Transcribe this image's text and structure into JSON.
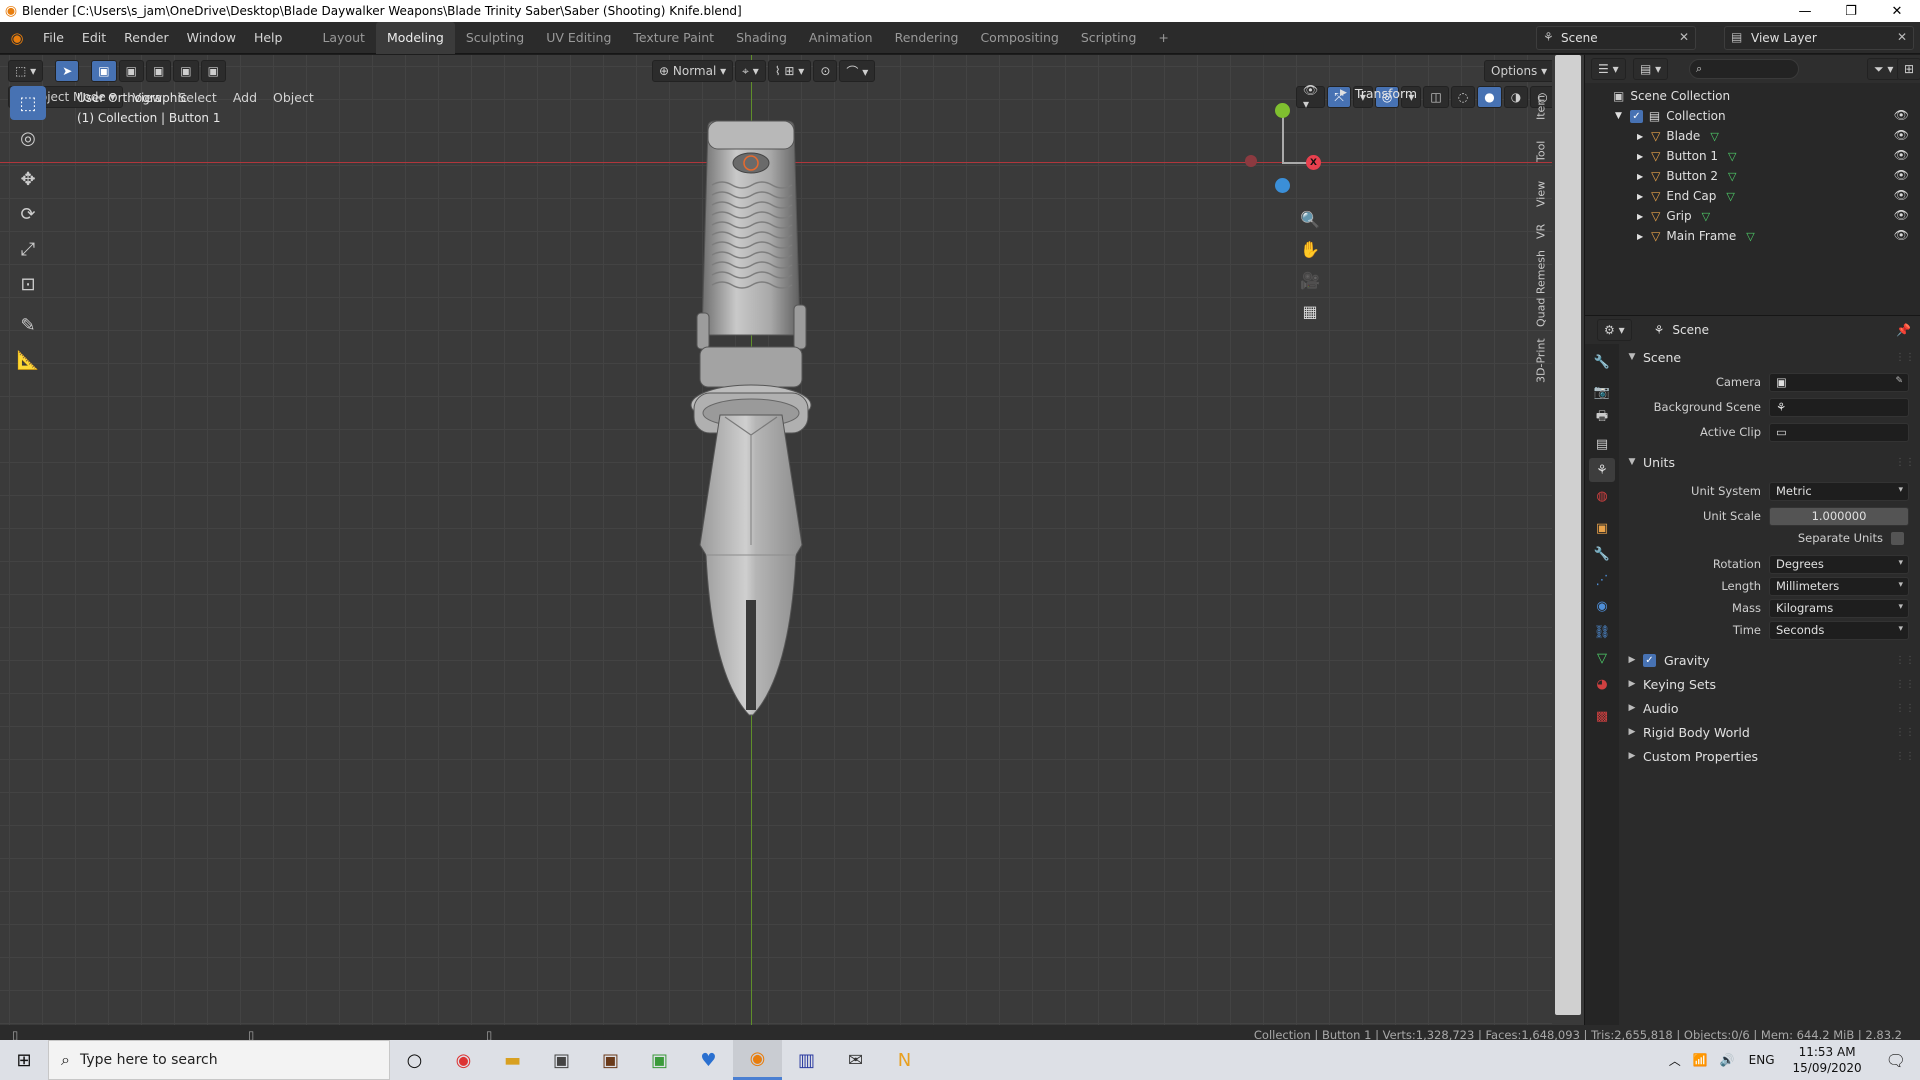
{
  "window": {
    "title": "Blender [C:\\Users\\s_jam\\OneDrive\\Desktop\\Blade Daywalker Weapons\\Blade Trinity Saber\\Saber (Shooting) Knife.blend]",
    "minimize": "—",
    "maximize": "❐",
    "close": "✕"
  },
  "menus": [
    "File",
    "Edit",
    "Render",
    "Window",
    "Help"
  ],
  "workspaces": [
    "Layout",
    "Modeling",
    "Sculpting",
    "UV Editing",
    "Texture Paint",
    "Shading",
    "Animation",
    "Rendering",
    "Compositing",
    "Scripting",
    "+"
  ],
  "active_workspace": "Modeling",
  "scene_field": "Scene",
  "view_layer_field": "View Layer",
  "viewport": {
    "mode": "Object Mode",
    "menus": [
      "View",
      "Select",
      "Add",
      "Object"
    ],
    "orientation": "Normal",
    "options": "Options",
    "view_name": "User Orthographic",
    "context": "(1) Collection | Button 1",
    "transform_panel": "Transform",
    "side_tabs": [
      "Item",
      "Tool",
      "View",
      "VR",
      "Quad Remesh",
      "3D-Print"
    ],
    "gizmo": {
      "x": "X",
      "y": "Y",
      "z": "Z"
    }
  },
  "outliner": {
    "root": "Scene Collection",
    "collection": "Collection",
    "objects": [
      "Blade",
      "Button 1",
      "Button 2",
      "End Cap",
      "Grip",
      "Main Frame"
    ]
  },
  "properties": {
    "header": "Scene",
    "scene_section": "Scene",
    "camera_label": "Camera",
    "background_scene_label": "Background Scene",
    "active_clip_label": "Active Clip",
    "units_section": "Units",
    "unit_system_label": "Unit System",
    "unit_system": "Metric",
    "unit_scale_label": "Unit Scale",
    "unit_scale": "1.000000",
    "separate_units_label": "Separate Units",
    "rotation_label": "Rotation",
    "rotation": "Degrees",
    "length_label": "Length",
    "length": "Millimeters",
    "mass_label": "Mass",
    "mass": "Kilograms",
    "time_label": "Time",
    "time": "Seconds",
    "collapsed_sections": [
      "Gravity",
      "Keying Sets",
      "Audio",
      "Rigid Body World",
      "Custom Properties"
    ]
  },
  "status_bar": "Collection | Button 1 | Verts:1,328,723 | Faces:1,648,093 | Tris:2,655,818 | Objects:0/6 | Mem: 644.2 MiB | 2.83.2",
  "taskbar": {
    "search_placeholder": "Type here to search",
    "language": "ENG",
    "time": "11:53 AM",
    "date": "15/09/2020"
  },
  "colors": {
    "accent": "#4772b3",
    "x_axis": "#e8404e",
    "y_axis": "#7fbf2f",
    "z_axis": "#3b8fd8",
    "blender_orange": "#e87d0d"
  }
}
